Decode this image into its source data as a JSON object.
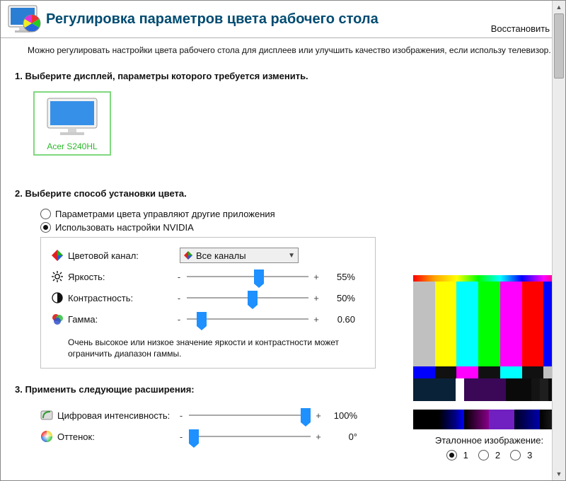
{
  "header": {
    "title": "Регулировка параметров цвета рабочего стола",
    "restore": "Восстановить"
  },
  "intro": "Можно регулировать настройки цвета рабочего стола для дисплеев или улучшить качество изображения, если использу телевизор.",
  "step1": {
    "heading": "1. Выберите дисплей, параметры которого требуется изменить.",
    "display_name": "Acer S240HL"
  },
  "step2": {
    "heading": "2. Выберите способ установки цвета.",
    "opt_other": "Параметрами цвета управляют другие приложения",
    "opt_nvidia": "Использовать настройки NVIDIA",
    "channel_label": "Цветовой канал:",
    "channel_value": "Все каналы",
    "brightness_label": "Яркость:",
    "brightness_value": "55%",
    "contrast_label": "Контрастность:",
    "contrast_value": "50%",
    "gamma_label": "Гамма:",
    "gamma_value": "0.60",
    "note": "Очень высокое или низкое значение яркости и контрастности может ограничить диапазон гаммы."
  },
  "step3": {
    "heading": "3. Применить следующие расширения:",
    "vibrance_label": "Цифровая интенсивность:",
    "vibrance_value": "100%",
    "hue_label": "Оттенок:",
    "hue_value": "0°"
  },
  "ref": {
    "caption": "Эталонное изображение:",
    "o1": "1",
    "o2": "2",
    "o3": "3"
  },
  "glyph": {
    "minus": "-",
    "plus": "+"
  }
}
